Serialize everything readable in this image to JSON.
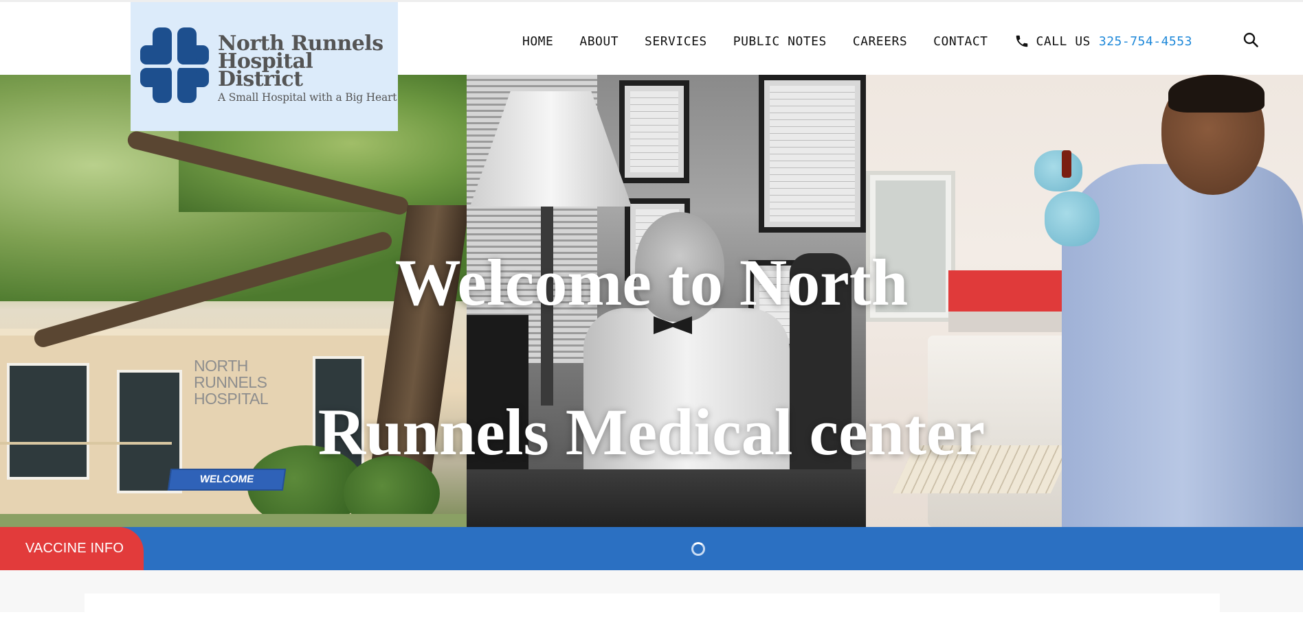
{
  "logo": {
    "line1": "North Runnels",
    "line2": "Hospital",
    "line3": "District",
    "tagline": "A Small Hospital with a Big Heart",
    "icon": "medical-cross-logo",
    "cross_color": "#1d4f8e"
  },
  "nav": {
    "items": [
      {
        "label": "HOME"
      },
      {
        "label": "ABOUT"
      },
      {
        "label": "SERVICES"
      },
      {
        "label": "PUBLIC NOTES"
      },
      {
        "label": "CAREERS"
      },
      {
        "label": "CONTACT"
      }
    ],
    "call_label": "CALL US",
    "phone": "325-754-4553",
    "phone_icon": "phone-icon",
    "search_icon": "search-icon",
    "phone_color": "#1e88d9"
  },
  "hero": {
    "title_line1": "Welcome to North",
    "title_line2": "Runnels Medical center",
    "panels": {
      "building_sign": [
        "NORTH",
        "RUNNELS",
        "HOSPITAL"
      ],
      "bench_text": "WELCOME"
    }
  },
  "ticker": {
    "label": "VACCINE INFO",
    "tab_color": "#e23b3b",
    "bar_color": "#2b70c2",
    "loading_icon": "spinner-icon"
  }
}
